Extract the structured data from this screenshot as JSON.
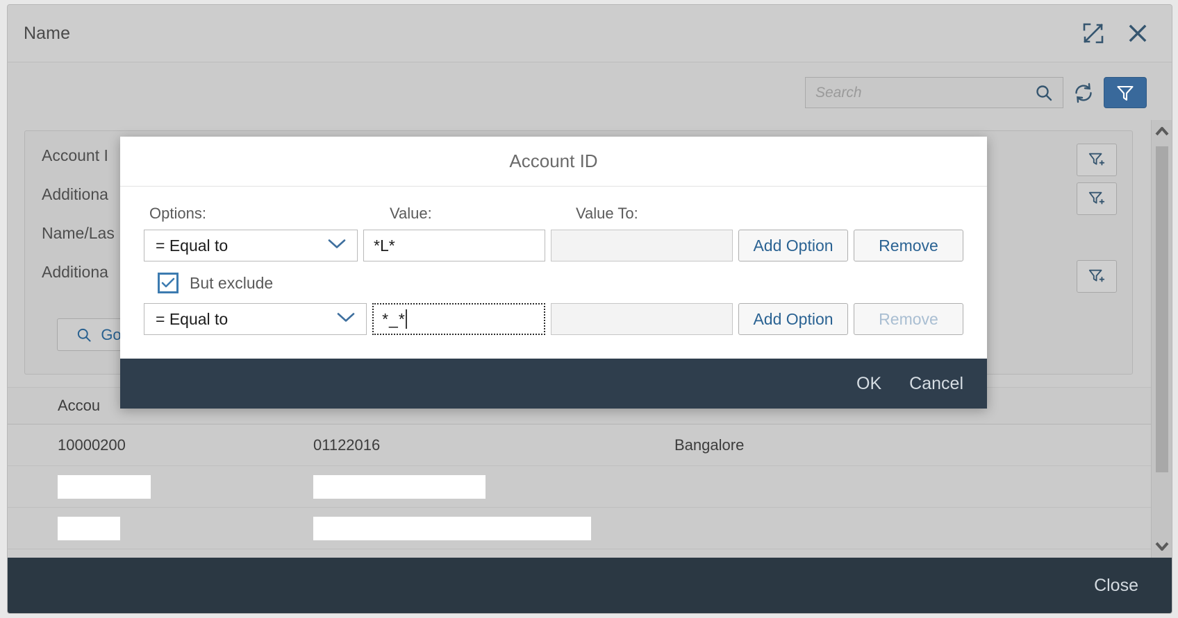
{
  "window": {
    "title": "Name",
    "maximize_icon": "expand-icon",
    "close_icon": "close-icon"
  },
  "toolbar": {
    "search_placeholder": "Search",
    "search_value": "",
    "search_icon": "search-icon",
    "refresh_icon": "refresh-icon",
    "filter_icon": "filter-icon"
  },
  "filter_bar": {
    "fields": [
      {
        "label": "Account I",
        "adv_icon": "filter-add-icon"
      },
      {
        "label": "Additiona",
        "adv_icon": "filter-add-icon"
      },
      {
        "label": "Name/Las",
        "adv_icon": ""
      },
      {
        "label": "Additiona",
        "adv_icon": "filter-add-icon"
      }
    ],
    "go_label": "Go",
    "go_icon": "search-icon"
  },
  "results_table": {
    "headers": [
      "Accou",
      "",
      ""
    ],
    "rows": [
      {
        "cells": [
          "10000200",
          "01122016",
          "Bangalore"
        ],
        "redacted": false
      },
      {
        "cells": [
          "",
          "",
          ""
        ],
        "redacted": true
      },
      {
        "cells": [
          "",
          "",
          ""
        ],
        "redacted": true
      }
    ]
  },
  "bottom_bar": {
    "close_label": "Close"
  },
  "scrollbar": {
    "up_icon": "chevron-up-icon",
    "down_icon": "chevron-down-icon"
  },
  "modal": {
    "title": "Account ID",
    "column_headers": {
      "options": "Options:",
      "value": "Value:",
      "value_to": "Value To:"
    },
    "rows": [
      {
        "operator": "= Equal to",
        "value": "*L*",
        "value_to": "",
        "add_label": "Add Option",
        "remove_label": "Remove",
        "remove_disabled": false,
        "focused": false
      },
      {
        "operator": "= Equal to",
        "value": "*_*",
        "value_to": "",
        "add_label": "Add Option",
        "remove_label": "Remove",
        "remove_disabled": true,
        "focused": true
      }
    ],
    "exclude": {
      "label": "But exclude",
      "checked": true
    },
    "footer": {
      "ok_label": "OK",
      "cancel_label": "Cancel"
    }
  },
  "colors": {
    "accent_blue": "#39699b",
    "link_blue": "#2b6393",
    "footer_dark": "#2f3e4d",
    "bar_dark": "#2b3843",
    "chrome_gray": "#cbcbcb"
  }
}
